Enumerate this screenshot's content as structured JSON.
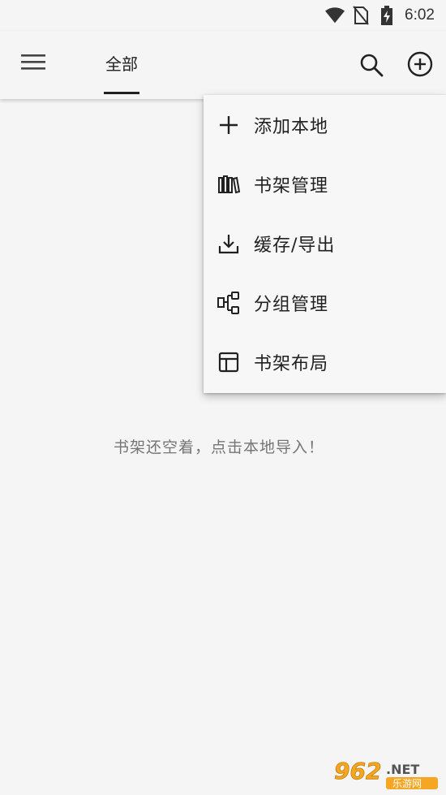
{
  "status_bar": {
    "time": "6:02",
    "icons": [
      "wifi-icon",
      "no-sim-icon",
      "battery-charging-icon"
    ]
  },
  "toolbar": {
    "menu_icon": "hamburger-menu-icon",
    "tab_label": "全部",
    "search_icon": "search-icon",
    "add_icon": "add-circle-icon"
  },
  "popup_menu": {
    "items": [
      {
        "label": "添加本地",
        "icon": "plus-icon"
      },
      {
        "label": "书架管理",
        "icon": "bookshelf-icon"
      },
      {
        "label": "缓存/导出",
        "icon": "download-icon"
      },
      {
        "label": "分组管理",
        "icon": "group-tree-icon"
      },
      {
        "label": "书架布局",
        "icon": "layout-icon"
      }
    ]
  },
  "main": {
    "empty_message": "书架还空着，点击本地导入！"
  },
  "watermark": {
    "brand": "962",
    "suffix": ".NET",
    "subtitle": "乐游网",
    "accent": "#f5a623"
  }
}
